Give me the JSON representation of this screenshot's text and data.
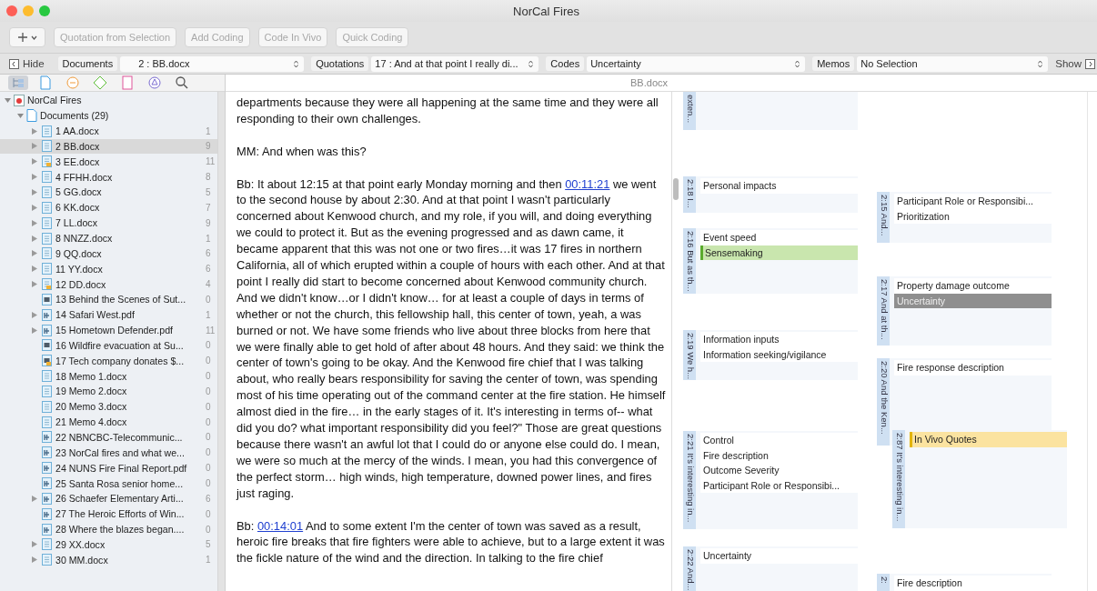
{
  "window": {
    "title": "NorCal Fires"
  },
  "toolbar": {
    "buttons": [
      {
        "label": "Quotation from Selection",
        "disabled": true
      },
      {
        "label": "Add Coding",
        "disabled": true
      },
      {
        "label": "Code In Vivo",
        "disabled": true
      },
      {
        "label": "Quick Coding",
        "disabled": true
      }
    ]
  },
  "navigator": {
    "hide": "Hide",
    "show": "Show",
    "selectors": [
      {
        "label": "Documents",
        "value": "2 : BB.docx"
      },
      {
        "label": "Quotations",
        "value": "17 : And at that point I really di..."
      },
      {
        "label": "Codes",
        "value": "Uncertainty"
      },
      {
        "label": "Memos",
        "value": "No Selection"
      }
    ]
  },
  "sidebar": {
    "tabs": [
      {
        "kind": "tree",
        "selected": true
      },
      {
        "kind": "document",
        "selected": false
      },
      {
        "kind": "quotation",
        "selected": false
      },
      {
        "kind": "code",
        "selected": false
      },
      {
        "kind": "memo",
        "selected": false
      },
      {
        "kind": "network",
        "selected": false
      },
      {
        "kind": "search",
        "selected": false
      }
    ],
    "tree": {
      "label": "NorCal Fires",
      "expanded": true,
      "children": [
        {
          "label": "Documents (29)",
          "expanded": true,
          "children": [
            {
              "label": "1 AA.docx",
              "count": "1",
              "kind": "text",
              "has_children": true,
              "commented": false,
              "selected": false
            },
            {
              "label": "2 BB.docx",
              "count": "9",
              "kind": "text",
              "has_children": true,
              "commented": false,
              "selected": true
            },
            {
              "label": "3 EE.docx",
              "count": "11",
              "kind": "text",
              "has_children": true,
              "commented": true,
              "selected": false
            },
            {
              "label": "4 FFHH.docx",
              "count": "8",
              "kind": "text",
              "has_children": true,
              "commented": false,
              "selected": false
            },
            {
              "label": "5 GG.docx",
              "count": "5",
              "kind": "text",
              "has_children": true,
              "commented": false,
              "selected": false
            },
            {
              "label": "6 KK.docx",
              "count": "7",
              "kind": "text",
              "has_children": true,
              "commented": false,
              "selected": false
            },
            {
              "label": "7 LL.docx",
              "count": "9",
              "kind": "text",
              "has_children": true,
              "commented": false,
              "selected": false
            },
            {
              "label": "8 NNZZ.docx",
              "count": "1",
              "kind": "text",
              "has_children": true,
              "commented": false,
              "selected": false
            },
            {
              "label": "9 QQ.docx",
              "count": "6",
              "kind": "text",
              "has_children": true,
              "commented": false,
              "selected": false
            },
            {
              "label": "11 YY.docx",
              "count": "6",
              "kind": "text",
              "has_children": true,
              "commented": false,
              "selected": false
            },
            {
              "label": "12 DD.docx",
              "count": "4",
              "kind": "text",
              "has_children": true,
              "commented": true,
              "selected": false
            },
            {
              "label": "13 Behind the Scenes of Sut...",
              "count": "0",
              "kind": "video",
              "has_children": false,
              "commented": false,
              "selected": false
            },
            {
              "label": "14 Safari West.pdf",
              "count": "1",
              "kind": "pdf",
              "has_children": true,
              "commented": false,
              "selected": false
            },
            {
              "label": "15 Hometown Defender.pdf",
              "count": "11",
              "kind": "pdf",
              "has_children": true,
              "commented": false,
              "selected": false
            },
            {
              "label": "16 Wildfire evacuation at Su...",
              "count": "0",
              "kind": "video",
              "has_children": false,
              "commented": false,
              "selected": false
            },
            {
              "label": "17 Tech company donates $...",
              "count": "0",
              "kind": "video",
              "has_children": false,
              "commented": true,
              "selected": false
            },
            {
              "label": "18 Memo 1.docx",
              "count": "0",
              "kind": "text",
              "has_children": false,
              "commented": false,
              "selected": false
            },
            {
              "label": "19 Memo 2.docx",
              "count": "0",
              "kind": "text",
              "has_children": false,
              "commented": false,
              "selected": false
            },
            {
              "label": "20 Memo 3.docx",
              "count": "0",
              "kind": "text",
              "has_children": false,
              "commented": false,
              "selected": false
            },
            {
              "label": "21 Memo 4.docx",
              "count": "0",
              "kind": "text",
              "has_children": false,
              "commented": false,
              "selected": false
            },
            {
              "label": "22 NBNCBC-Telecommunic...",
              "count": "0",
              "kind": "pdf",
              "has_children": false,
              "commented": false,
              "selected": false
            },
            {
              "label": "23 NorCal fires and what we...",
              "count": "0",
              "kind": "pdf",
              "has_children": false,
              "commented": false,
              "selected": false
            },
            {
              "label": "24 NUNS Fire Final Report.pdf",
              "count": "0",
              "kind": "pdf",
              "has_children": false,
              "commented": false,
              "selected": false
            },
            {
              "label": "25 Santa Rosa senior home...",
              "count": "0",
              "kind": "pdf",
              "has_children": false,
              "commented": false,
              "selected": false
            },
            {
              "label": "26 Schaefer Elementary Arti...",
              "count": "6",
              "kind": "pdf",
              "has_children": true,
              "commented": false,
              "selected": false
            },
            {
              "label": "27 The Heroic Efforts of Win...",
              "count": "0",
              "kind": "pdf",
              "has_children": false,
              "commented": false,
              "selected": false
            },
            {
              "label": "28 Where the blazes began....",
              "count": "0",
              "kind": "pdf",
              "has_children": false,
              "commented": false,
              "selected": false
            },
            {
              "label": "29 XX.docx",
              "count": "5",
              "kind": "text",
              "has_children": true,
              "commented": false,
              "selected": false
            },
            {
              "label": "30 MM.docx",
              "count": "1",
              "kind": "text",
              "has_children": true,
              "commented": false,
              "selected": false
            }
          ]
        }
      ]
    }
  },
  "document": {
    "title": "BB.docx",
    "paragraphs": [
      [
        {
          "kind": "text",
          "text": "departments because they were all happening at the same time and they were all responding to their own challenges."
        }
      ],
      [
        {
          "kind": "text",
          "text": "MM: And when was this?"
        }
      ],
      [
        {
          "kind": "text",
          "text": "Bb: It about 12:15 at that point early Monday morning and then "
        },
        {
          "kind": "link",
          "text": "00:11:21"
        },
        {
          "kind": "text",
          "text": " we went to the second house by about 2:30. And at that point I wasn't particularly concerned about Kenwood church, and my role, if you will, and doing everything we could to protect it. But as the evening progressed and as dawn came, it became apparent that this was not one or two fires…it was 17 fires in northern California, all of which erupted within a couple of hours with each other. And at that point I really did start to become concerned about Kenwood community church. And we didn't know…or I didn't know… for at least a couple of days in terms of whether or not the church, this fellowship hall, this center of town, yeah, a was burned or not. We have some friends who live about three blocks from here that we were finally able to get hold of after about 48 hours. And they said: we think the center of town's going to be okay. And the Kenwood fire chief that I was talking about, who really bears responsibility for saving the center of town, was spending most of his time operating out of the command center at the fire station. He himself almost died in the fire… in the early stages of it. It's interesting in terms of-- what did you do? what important responsibility did you feel?\" Those are great questions because there wasn't an awful lot that I could do or anyone else could do. I mean, we were so much at the mercy of the winds. I mean, you had this convergence of the perfect storm… high winds, high temperature, downed power lines, and fires just raging."
        }
      ],
      [
        {
          "kind": "text",
          "text": "Bb: "
        },
        {
          "kind": "link",
          "text": "00:14:01"
        },
        {
          "kind": "text",
          "text": " And to some extent I'm the center of town was saved as a result, heroic fire breaks that fire fighters were able to achieve, but to a large extent it was the fickle nature of the wind and the direction. In talking to the fire chief"
        }
      ]
    ]
  },
  "margin": {
    "quotations": [
      {
        "label": "exten..."
      },
      {
        "label": "2:18 I...",
        "codes": [
          {
            "label": "Personal impacts",
            "selected": false
          }
        ]
      },
      {
        "label": "2:16 But as th...",
        "codes": [
          {
            "label": "Event speed",
            "selected": false
          },
          {
            "label": "Sensemaking",
            "selected": false,
            "color": "#c9e6ae"
          }
        ]
      },
      {
        "label": "2:19 We h...",
        "codes": [
          {
            "label": "Information inputs",
            "selected": false
          },
          {
            "label": "Information seeking/vigilance",
            "selected": false
          }
        ]
      },
      {
        "label": "2:21 It's interesting in...",
        "codes": [
          {
            "label": "Control",
            "selected": false
          },
          {
            "label": "Fire description",
            "selected": false
          },
          {
            "label": "Outcome Severity",
            "selected": false
          },
          {
            "label": "Participant Role or Responsibi...",
            "selected": false
          }
        ]
      },
      {
        "label": "2:22 And...",
        "codes": [
          {
            "label": "Uncertainty",
            "selected": false
          }
        ]
      },
      {
        "label": "2:15 And...",
        "codes": [
          {
            "label": "Participant Role or Responsibi...",
            "selected": false
          },
          {
            "label": "Prioritization",
            "selected": false
          }
        ]
      },
      {
        "label": "2:17 And at th...",
        "codes": [
          {
            "label": "Property damage outcome",
            "selected": false
          },
          {
            "label": "Uncertainty",
            "selected": true
          }
        ]
      },
      {
        "label": "2:20 And the Ken...",
        "codes": [
          {
            "label": "Fire response description",
            "selected": false
          }
        ]
      },
      {
        "label": "2:87 It's interesting in...",
        "codes": [
          {
            "label": "In Vivo Quotes",
            "selected": false,
            "color": "#fbe3a0"
          }
        ]
      },
      {
        "label": "2:",
        "codes": [
          {
            "label": "Fire description",
            "selected": false
          }
        ]
      }
    ]
  }
}
